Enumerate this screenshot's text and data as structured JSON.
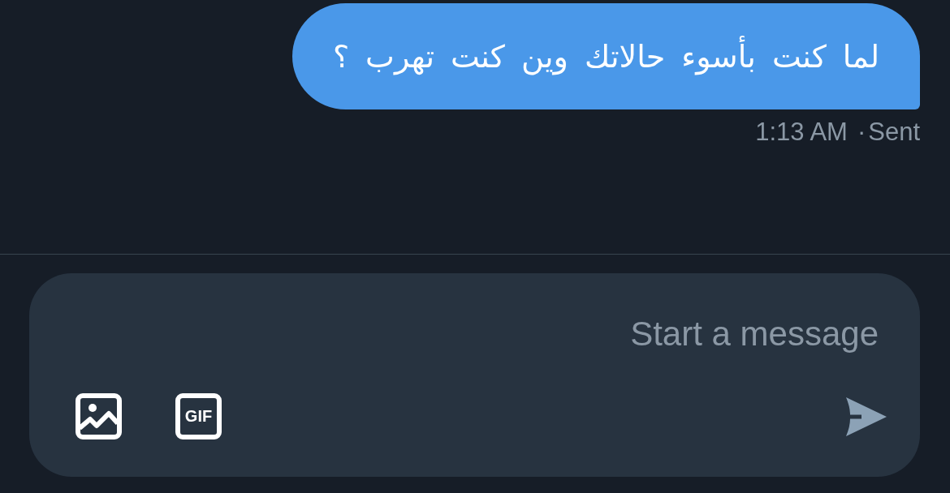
{
  "messages": [
    {
      "text": "لما كنت بأسوء حالاتك وين كنت تهرب ؟",
      "time": "1:13 AM",
      "separator": "·",
      "status": "Sent"
    }
  ],
  "composer": {
    "placeholder": "Start a message",
    "attachments": [
      {
        "kind": "image"
      },
      {
        "kind": "gif",
        "label": "GIF"
      }
    ],
    "send_button": {
      "disabled": true
    }
  }
}
